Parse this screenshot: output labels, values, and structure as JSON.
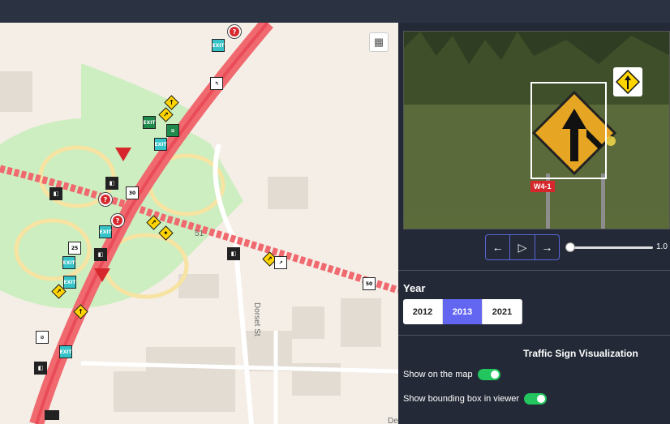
{
  "map": {
    "streets": [
      {
        "name": "Dorset St"
      },
      {
        "name": "51"
      },
      {
        "name": "De"
      }
    ],
    "layer_control_icon": "qr-layer-icon",
    "signs": [
      {
        "type": "circle-red",
        "text": "?"
      },
      {
        "type": "teal",
        "text": "EXIT"
      },
      {
        "type": "white",
        "text": "↰"
      },
      {
        "type": "diamond",
        "text": "↑"
      },
      {
        "type": "diamond",
        "text": "↗"
      },
      {
        "type": "green",
        "text": "EXIT"
      },
      {
        "type": "green",
        "text": "≡"
      },
      {
        "type": "teal",
        "text": "EXIT"
      },
      {
        "type": "yield",
        "text": ""
      },
      {
        "type": "black",
        "text": "◧"
      },
      {
        "type": "circle-red",
        "text": "?"
      },
      {
        "type": "white",
        "text": "30"
      },
      {
        "type": "black",
        "text": "◧"
      },
      {
        "type": "circle-red",
        "text": "?"
      },
      {
        "type": "teal",
        "text": "EXIT"
      },
      {
        "type": "diamond",
        "text": "↗"
      },
      {
        "type": "diamond",
        "text": "✦"
      },
      {
        "type": "teal",
        "text": "EXIT"
      },
      {
        "type": "white",
        "text": "25"
      },
      {
        "type": "black",
        "text": "◧"
      },
      {
        "type": "teal",
        "text": "EXIT"
      },
      {
        "type": "yield",
        "text": ""
      },
      {
        "type": "diamond",
        "text": "↗"
      },
      {
        "type": "diamond",
        "text": "↑"
      },
      {
        "type": "white",
        "text": "⊘"
      },
      {
        "type": "teal",
        "text": "EXIT"
      },
      {
        "type": "black",
        "text": "◧"
      },
      {
        "type": "black",
        "text": "◧"
      },
      {
        "type": "diamond",
        "text": "↗"
      },
      {
        "type": "white",
        "text": "↗"
      },
      {
        "type": "white",
        "text": "50"
      }
    ]
  },
  "viewer": {
    "label": "W4-1",
    "thumb_icon": "merge-sign-icon"
  },
  "playback": {
    "prev_icon": "←",
    "play_icon": "▷",
    "next_icon": "→",
    "slider_value": "1.0"
  },
  "year": {
    "label": "Year",
    "options": [
      "2012",
      "2013",
      "2021"
    ],
    "selected": "2013"
  },
  "viz": {
    "title": "Traffic Sign Visualization",
    "show_on_map": "Show on the map",
    "show_bbox": "Show bounding box in viewer"
  },
  "colors": {
    "highway": "#f0696f",
    "highway_core": "#e94c57",
    "park": "#cdeec0",
    "accent": "#6366f1",
    "toggle_on": "#22c55e",
    "bbox_label": "#d6282c"
  }
}
